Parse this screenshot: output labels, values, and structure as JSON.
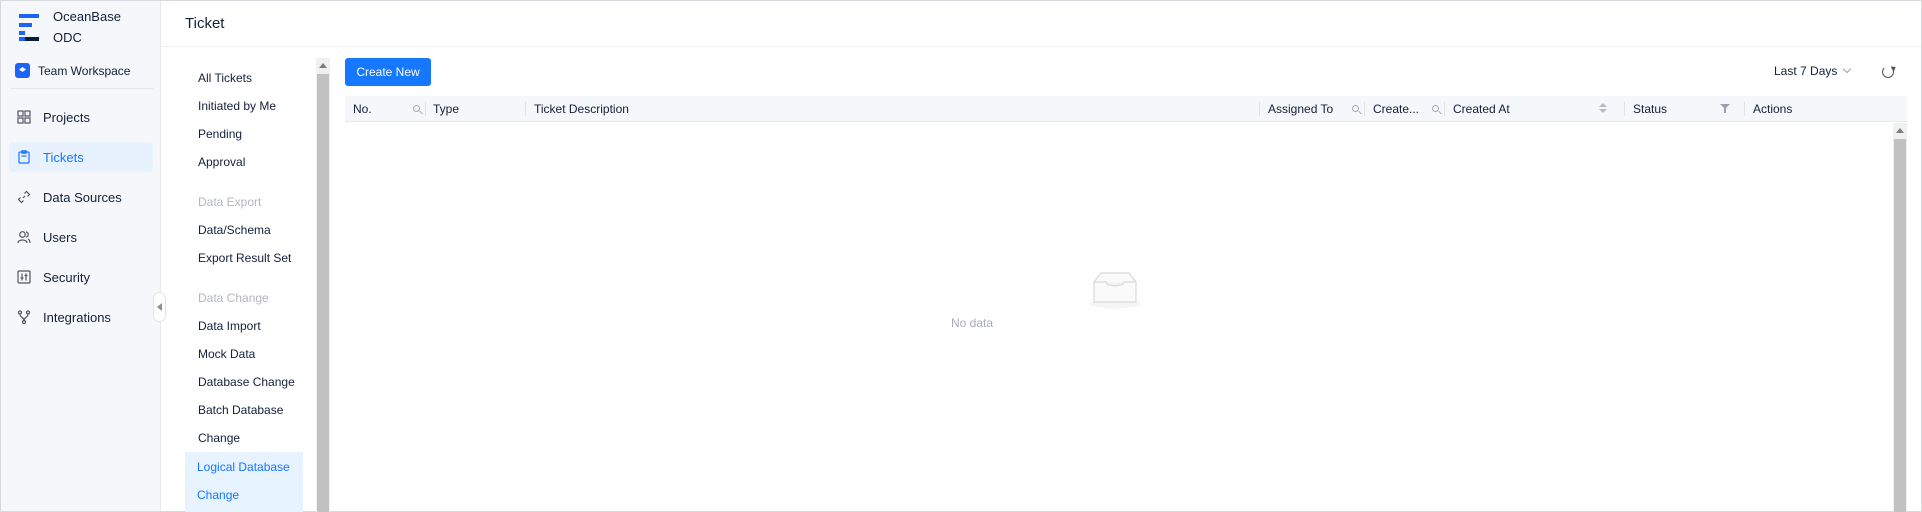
{
  "brand": {
    "line1": "OceanBase",
    "line2": "ODC",
    "logo_color": "#1b64f6"
  },
  "workspace": {
    "label": "Team Workspace",
    "icon": "workspace-icon"
  },
  "nav": {
    "items": [
      {
        "label": "Projects",
        "icon": "grid-icon",
        "active": false
      },
      {
        "label": "Tickets",
        "icon": "clipboard-icon",
        "active": true
      },
      {
        "label": "Data Sources",
        "icon": "link-icon",
        "active": false
      },
      {
        "label": "Users",
        "icon": "users-icon",
        "active": false
      },
      {
        "label": "Security",
        "icon": "sliders-icon",
        "active": false
      },
      {
        "label": "Integrations",
        "icon": "branch-icon",
        "active": false
      }
    ],
    "active_color": "#1677ff"
  },
  "header": {
    "title": "Ticket"
  },
  "submenu": {
    "items": [
      "All Tickets",
      "Initiated by Me",
      "Pending",
      "Approval"
    ],
    "group_export": "Data Export",
    "export_items": [
      "Data/Schema",
      "Export Result Set"
    ],
    "group_change": "Data Change",
    "change_items": [
      "Data Import",
      "Mock Data",
      "Database Change",
      "Batch Database",
      "Change"
    ],
    "active_line1": "Logical Database",
    "active_line2": "Change"
  },
  "toolbar": {
    "create_label": "Create New",
    "range_label": "Last 7 Days",
    "refresh_icon": "refresh-icon"
  },
  "table": {
    "columns": [
      "No.",
      "Type",
      "Ticket Description",
      "Assigned To",
      "Create...",
      "Created At",
      "Status",
      "Actions"
    ],
    "rows": [],
    "empty_text": "No data"
  }
}
